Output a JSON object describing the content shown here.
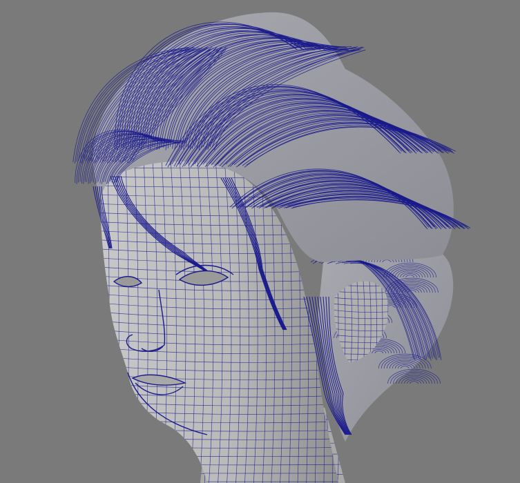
{
  "viewport": {
    "background_color": "#7a7a7a",
    "mesh_fill_color": "#bdbdbd",
    "mesh_shadow_color": "#8e8e8e",
    "wire_color": "#1a1a8c",
    "subject": "wireframe-head-with-hair"
  }
}
